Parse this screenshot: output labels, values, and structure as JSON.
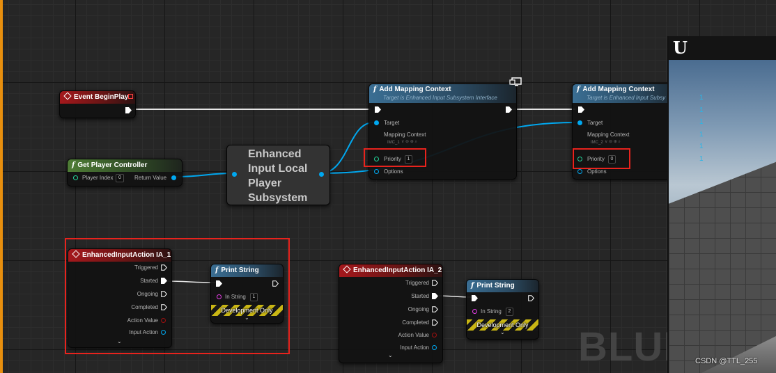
{
  "graph": {
    "watermark": "BLUE",
    "credit": "CSDN @TTL_255"
  },
  "nodes": {
    "event_begin_play": {
      "title": "Event BeginPlay"
    },
    "get_player_controller": {
      "title": "Get Player Controller",
      "player_index_label": "Player Index",
      "player_index_value": "0",
      "return_value_label": "Return Value"
    },
    "subsystem": {
      "title": "Enhanced Input Local Player Subsystem"
    },
    "add_mapping_1": {
      "title": "Add Mapping Context",
      "subtitle": "Target is Enhanced Input Subsystem Interface",
      "target_label": "Target",
      "mapping_context_label": "Mapping Context",
      "mapping_context_value": "IMC_1",
      "priority_label": "Priority",
      "priority_value": "1",
      "options_label": "Options"
    },
    "add_mapping_2": {
      "title": "Add Mapping Context",
      "subtitle": "Target is Enhanced Input Subsy",
      "target_label": "Target",
      "mapping_context_label": "Mapping Context",
      "mapping_context_value": "IMC_2",
      "priority_label": "Priority",
      "priority_value": "0",
      "options_label": "Options"
    },
    "input_action_1": {
      "title": "EnhancedInputAction IA_1",
      "pins": [
        "Triggered",
        "Started",
        "Ongoing",
        "Completed",
        "Action Value",
        "Input Action"
      ]
    },
    "print_string_1": {
      "title": "Print String",
      "in_string_label": "In String",
      "in_string_value": "1",
      "dev_label": "Development Only"
    },
    "input_action_2": {
      "title": "EnhancedInputAction IA_2",
      "pins": [
        "Triggered",
        "Started",
        "Ongoing",
        "Completed",
        "Action Value",
        "Input Action"
      ]
    },
    "print_string_2": {
      "title": "Print String",
      "in_string_label": "In String",
      "in_string_value": "2",
      "dev_label": "Development Only"
    }
  },
  "viewport": {
    "logo": "U",
    "log_lines": [
      "1",
      "1",
      "1",
      "1",
      "1",
      "1"
    ]
  },
  "colors": {
    "exec_wire": "#e6e6e6",
    "object_wire": "#00a8f0",
    "highlight_frame": "#e8231d",
    "event_header": "#a5181c",
    "pure_header": "#4f7d36",
    "function_header": "#3a6e93"
  }
}
